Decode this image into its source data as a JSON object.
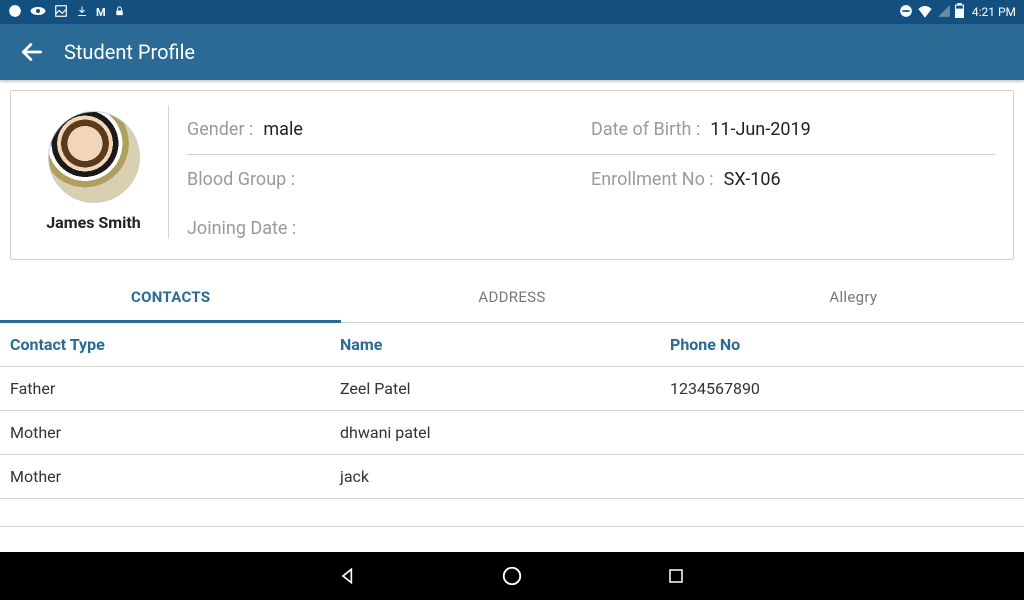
{
  "status": {
    "time": "4:21 PM"
  },
  "header": {
    "title": "Student Profile"
  },
  "profile": {
    "name": "James Smith",
    "gender_label": "Gender :",
    "gender": "male",
    "dob_label": "Date of Birth :",
    "dob": "11-Jun-2019",
    "blood_label": "Blood Group :",
    "blood": "",
    "enroll_label": "Enrollment No :",
    "enroll": "SX-106",
    "joining_label": "Joining Date :",
    "joining": ""
  },
  "tabs": [
    {
      "label": "CONTACTS",
      "active": true
    },
    {
      "label": "ADDRESS",
      "active": false
    },
    {
      "label": "Allegry",
      "active": false
    }
  ],
  "contacts_table": {
    "headers": {
      "type": "Contact Type",
      "name": "Name",
      "phone": "Phone No"
    },
    "rows": [
      {
        "type": "Father",
        "name": "Zeel  Patel",
        "phone": "1234567890"
      },
      {
        "type": "Mother",
        "name": "dhwani patel",
        "phone": ""
      },
      {
        "type": "Mother",
        "name": "jack",
        "phone": ""
      }
    ]
  }
}
